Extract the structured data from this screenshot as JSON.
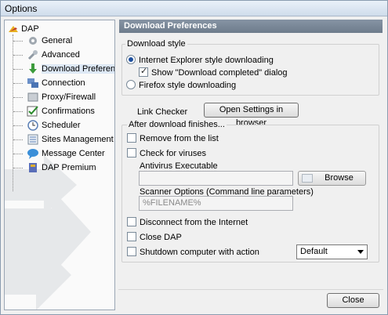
{
  "window": {
    "title": "Options"
  },
  "tree": {
    "root": "DAP",
    "items": [
      {
        "label": "General",
        "icon": "gear-icon"
      },
      {
        "label": "Advanced",
        "icon": "wrench-icon"
      },
      {
        "label": "Download Preferences",
        "icon": "download-arrow-icon"
      },
      {
        "label": "Connection",
        "icon": "network-icon"
      },
      {
        "label": "Proxy/Firewall",
        "icon": "proxy-icon"
      },
      {
        "label": "Confirmations",
        "icon": "checkmark-icon"
      },
      {
        "label": "Scheduler",
        "icon": "clock-icon"
      },
      {
        "label": "Sites Management",
        "icon": "list-icon"
      },
      {
        "label": "Message Center",
        "icon": "speech-bubble-icon"
      },
      {
        "label": "DAP Premium",
        "icon": "premium-box-icon"
      }
    ]
  },
  "panel": {
    "title": "Download Preferences",
    "download_style": {
      "label": "Download style",
      "ie_option": "Internet Explorer style downloading",
      "show_completed": "Show \"Download completed\" dialog",
      "firefox_option": "Firefox style downloading"
    },
    "link_checker": {
      "label": "Link Checker",
      "button": "Open Settings in browser"
    },
    "after_download": {
      "label": "After download finishes...",
      "remove": "Remove from the list",
      "check_viruses": "Check for viruses",
      "antivirus_label": "Antivirus Executable",
      "antivirus_value": "",
      "browse": "Browse",
      "scanner_label": "Scanner Options (Command line parameters)",
      "scanner_value": "%FILENAME%",
      "disconnect": "Disconnect from the Internet",
      "close_dap": "Close DAP",
      "shutdown": "Shutdown computer with action",
      "shutdown_select": "Default"
    }
  },
  "footer": {
    "close": "Close"
  }
}
